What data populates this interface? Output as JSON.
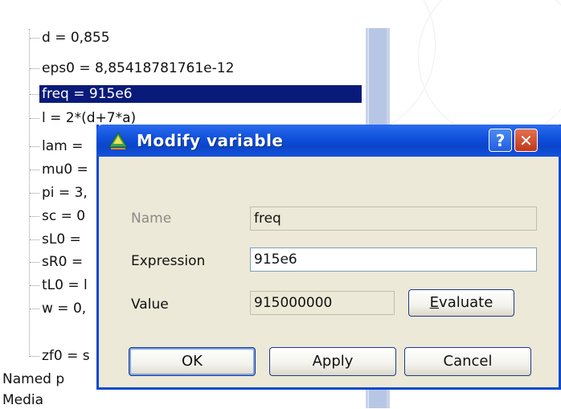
{
  "tree": {
    "items": [
      {
        "label": "d = 0,855",
        "selected": false
      },
      {
        "label": "eps0 = 8,85418781761e-12",
        "selected": false
      },
      {
        "label": "freq = 915e6",
        "selected": true
      },
      {
        "label": "l = 2*(d+7*a)",
        "selected": false
      },
      {
        "label": "lam = ",
        "selected": false
      },
      {
        "label": "mu0 = ",
        "selected": false
      },
      {
        "label": "pi = 3,",
        "selected": false
      },
      {
        "label": "sc = 0",
        "selected": false
      },
      {
        "label": "sL0 = ",
        "selected": false
      },
      {
        "label": "sR0 = ",
        "selected": false
      },
      {
        "label": "tL0 = l",
        "selected": false
      },
      {
        "label": "w = 0,",
        "selected": false
      },
      {
        "label": "zf0 = s",
        "selected": false
      }
    ],
    "roots": [
      "Named p",
      "Media"
    ]
  },
  "dialog": {
    "title": "Modify variable",
    "help_label": "?",
    "close_label": "✕",
    "name_label": "Name",
    "name_value": "freq",
    "expression_label": "Expression",
    "expression_value": "915e6",
    "value_label": "Value",
    "value_value": "915000000",
    "evaluate_mnemonic": "E",
    "evaluate_rest": "valuate",
    "ok_label": "OK",
    "apply_label": "Apply",
    "cancel_label": "Cancel"
  },
  "colors": {
    "selection": "#0a1a7a",
    "titlebar": "#0f4fd9",
    "dialog_bg": "#ece9d8"
  }
}
